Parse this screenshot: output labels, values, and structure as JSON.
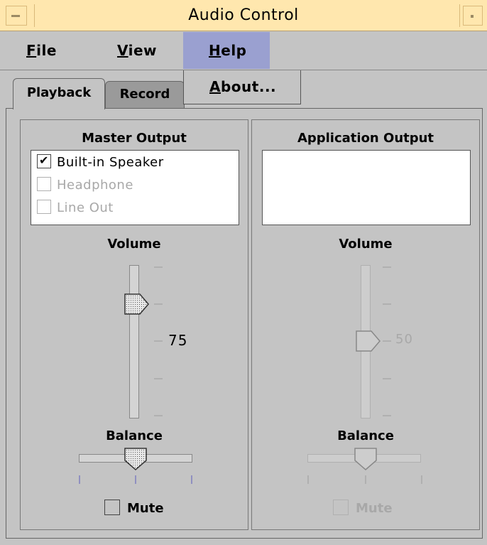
{
  "window": {
    "title": "Audio Control"
  },
  "menubar": {
    "file": {
      "mnemonic": "F",
      "rest": "ile"
    },
    "view": {
      "mnemonic": "V",
      "rest": "iew"
    },
    "help": {
      "mnemonic": "H",
      "rest": "elp"
    }
  },
  "help_menu": {
    "about": {
      "mnemonic": "A",
      "rest": "bout..."
    }
  },
  "tabs": [
    {
      "label": "Playback",
      "active": true
    },
    {
      "label": "Record",
      "active": false
    }
  ],
  "master": {
    "title": "Master Output",
    "devices": [
      {
        "label": "Built-in Speaker",
        "checked": true,
        "enabled": true
      },
      {
        "label": "Headphone",
        "checked": false,
        "enabled": false
      },
      {
        "label": "Line Out",
        "checked": false,
        "enabled": false
      }
    ],
    "volume_label": "Volume",
    "volume_value": "75",
    "balance_label": "Balance",
    "balance_value": 0,
    "mute_label": "Mute",
    "muted": false
  },
  "application": {
    "title": "Application Output",
    "devices": [],
    "volume_label": "Volume",
    "volume_value": "50",
    "balance_label": "Balance",
    "balance_value": 0,
    "mute_label": "Mute",
    "enabled": false
  },
  "colors": {
    "title_bar": "#ffe7ae",
    "menu_highlight": "#9aa0d0",
    "background": "#c4c4c4"
  }
}
